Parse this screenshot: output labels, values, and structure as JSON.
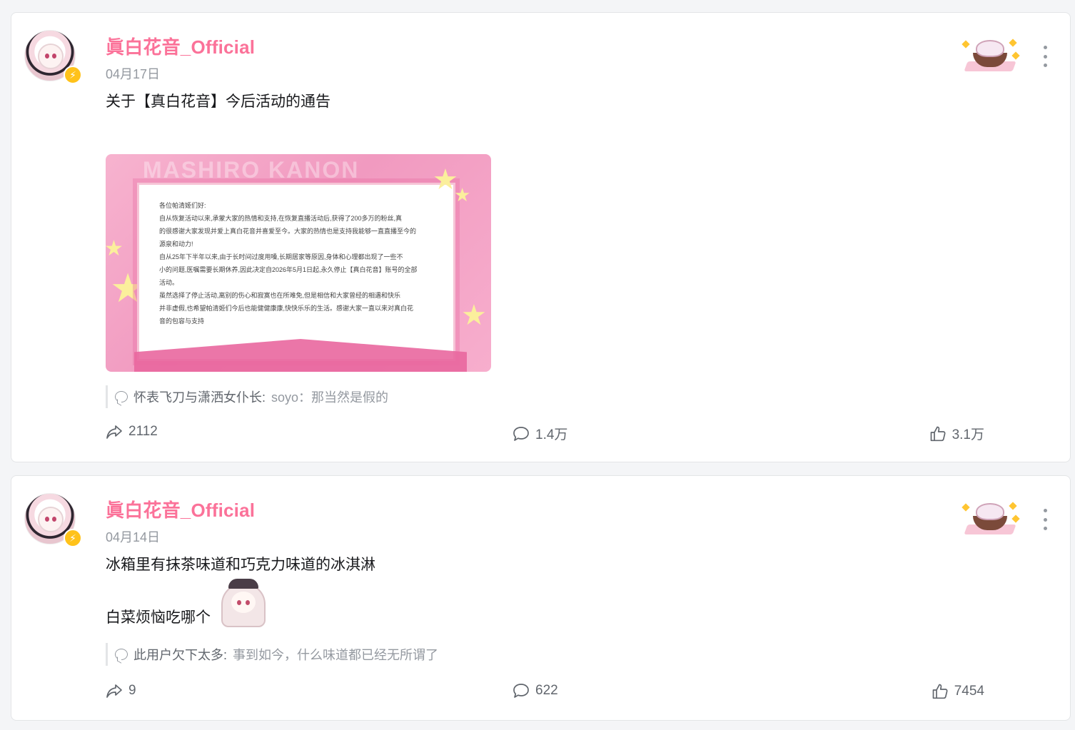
{
  "posts": [
    {
      "username": "眞白花音_Official",
      "date": "04月17日",
      "text": "关于【真白花音】今后活动的通告",
      "image": {
        "brand": "MASHIRO KANON",
        "lines": [
          "各位帕清姬们好:",
          "    自从恢复活动以来,承蒙大家的热情和支持,在恢复直播活动后,获得了200多万的粉丝,真",
          "的很感谢大家发现并爱上真白花音并喜爱至今。大家的热情也是支持我能够一直直播至今的",
          "源泉和动力!",
          "    自从25年下半年以来,由于长时间过度用嗓,长期居家等原因,身体和心理都出现了一些不",
          "小的问题,医嘱需要长期休养,因此决定自2026年5月1日起,永久停止【真白花音】账号的全部",
          "活动。",
          "    虽然选择了停止活动,离别的伤心和寂寞也在所难免,但是相信和大家曾经的相遇和快乐",
          "并非虚假,也希望帕清姬们今后也能健健康康,快快乐乐的生活。感谢大家一直以来对真白花",
          "音的包容与支持"
        ]
      },
      "comment_preview": {
        "author": "怀表飞刀与潇洒女仆长:",
        "text": "soyo：那当然是假的"
      },
      "stats": {
        "shares": "2112",
        "comments": "1.4万",
        "likes": "3.1万"
      }
    },
    {
      "username": "眞白花音_Official",
      "date": "04月14日",
      "text_line1": "冰箱里有抹茶味道和巧克力味道的冰淇淋",
      "text_line2": "白菜烦恼吃哪个",
      "comment_preview": {
        "author": "此用户欠下太多:",
        "text": "事到如今，什么味道都已经无所谓了"
      },
      "stats": {
        "shares": "9",
        "comments": "622",
        "likes": "7454"
      }
    }
  ],
  "colors": {
    "accent": "#fb7299",
    "muted": "#9499a0",
    "badge": "#ffc21a"
  },
  "icons": [
    "avatar",
    "lightning-icon",
    "more-icon",
    "share-icon",
    "comment-icon",
    "like-icon",
    "speech-bubble-icon"
  ]
}
